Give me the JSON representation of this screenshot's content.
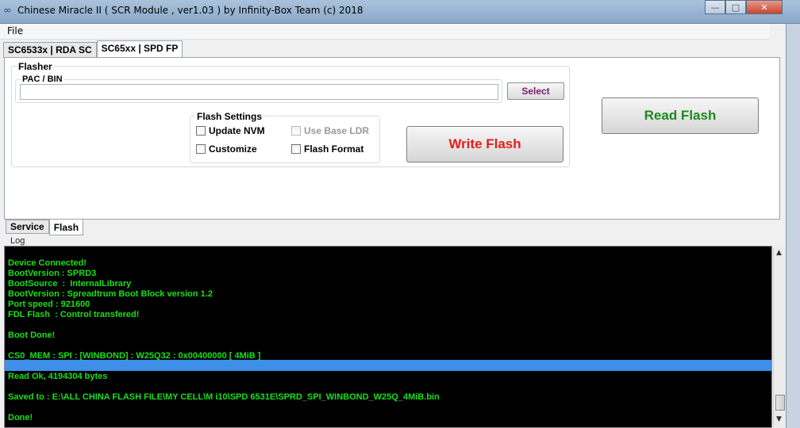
{
  "window": {
    "title": "Chinese Miracle II ( SCR Module , ver1.03  ) by Infinity-Box Team (c) 2018",
    "icon": "infinity-icon",
    "min_glyph": "—",
    "max_glyph": "□",
    "close_glyph": "✕"
  },
  "menu": {
    "file": "File"
  },
  "top_tabs": [
    {
      "label": "SC6533x | RDA SC"
    },
    {
      "label": "SC65xx | SPD FP"
    }
  ],
  "flasher": {
    "legend": "Flasher",
    "pac_legend": "PAC / BIN",
    "pac_value": "",
    "select_label": "Select",
    "settings_legend": "Flash Settings",
    "update_nvm": "Update NVM",
    "use_base_ldr": "Use Base LDR",
    "customize": "Customize",
    "flash_format": "Flash Format",
    "write_label": "Write Flash",
    "read_label": "Read Flash"
  },
  "bottom_tabs": [
    {
      "label": "Service"
    },
    {
      "label": "Flash"
    }
  ],
  "log": {
    "label": "Log",
    "text": "Device Connected!\nBootVersion : SPRD3\nBootSource  :  InternalLibrary\nBootVersion : Spreadtrum Boot Block version 1.2\nPort speed : 921600\nFDL Flash  : Control transfered!\n\nBoot Done!\n\nCS0_MEM : SPI : [WINBOND] : W25Q32 : 0x00400000 [ 4MiB ]\n\nRead Ok, 4194304 bytes\n\nSaved to : E:\\ALL CHINA FLASH FILE\\MY CELL\\M i10\\SPD 6531E\\SPRD_SPI_WINBOND_W25Q_4MiB.bin\n\nDone!"
  },
  "colors": {
    "write_text": "#e81c1c",
    "read_text": "#1d8a1d",
    "select_text": "#7a1a6a",
    "log_text": "#17e017",
    "log_bg": "#000000",
    "selection": "#3d8fe8"
  }
}
